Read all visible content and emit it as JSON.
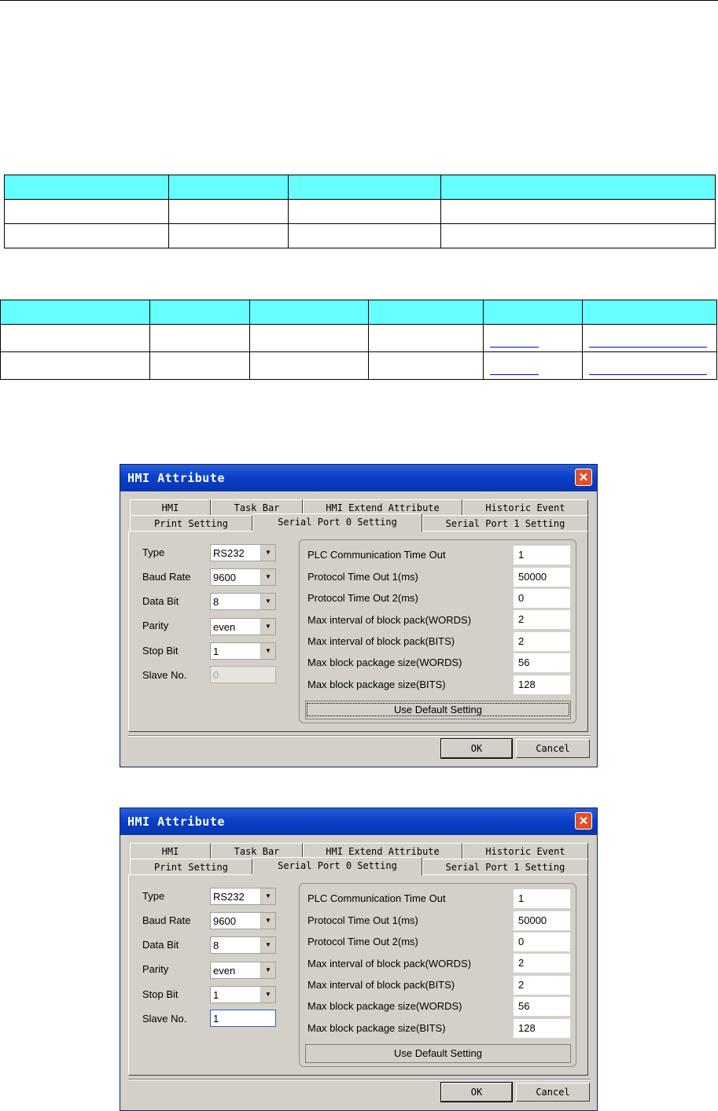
{
  "dialog1": {
    "title": "HMI Attribute",
    "tabs_row1": [
      "HMI",
      "Task Bar",
      "HMI Extend Attribute",
      "Historic Event"
    ],
    "tabs_row2": [
      "Print Setting",
      "Serial Port 0 Setting",
      "Serial Port 1 Setting"
    ],
    "labels": [
      "Type",
      "Baud Rate",
      "Data Bit",
      "Parity",
      "Stop Bit",
      "Slave No."
    ],
    "values": [
      "RS232",
      "9600",
      "8",
      "even",
      "1",
      "0"
    ],
    "params": [
      {
        "label": "PLC Communication Time Out",
        "value": "1"
      },
      {
        "label": "Protocol Time Out 1(ms)",
        "value": "50000"
      },
      {
        "label": "Protocol Time Out 2(ms)",
        "value": "0"
      },
      {
        "label": "Max interval of block pack(WORDS)",
        "value": "2"
      },
      {
        "label": "Max interval of block pack(BITS)",
        "value": "2"
      },
      {
        "label": "Max block package size(WORDS)",
        "value": "56"
      },
      {
        "label": "Max block package size(BITS)",
        "value": "128"
      }
    ],
    "default_button": "Use Default Setting",
    "ok": "OK",
    "cancel": "Cancel"
  },
  "dialog2": {
    "title": "HMI Attribute",
    "tabs_row1": [
      "HMI",
      "Task Bar",
      "HMI Extend Attribute",
      "Historic Event"
    ],
    "tabs_row2": [
      "Print Setting",
      "Serial Port 0 Setting",
      "Serial Port 1 Setting"
    ],
    "labels": [
      "Type",
      "Baud Rate",
      "Data Bit",
      "Parity",
      "Stop Bit",
      "Slave No."
    ],
    "values": [
      "RS232",
      "9600",
      "8",
      "even",
      "1",
      "1"
    ],
    "params": [
      {
        "label": "PLC Communication Time Out",
        "value": "1"
      },
      {
        "label": "Protocol Time Out 1(ms)",
        "value": "50000"
      },
      {
        "label": "Protocol Time Out 2(ms)",
        "value": "0"
      },
      {
        "label": "Max interval of block pack(WORDS)",
        "value": "2"
      },
      {
        "label": "Max interval of block pack(BITS)",
        "value": "2"
      },
      {
        "label": "Max block package size(WORDS)",
        "value": "56"
      },
      {
        "label": "Max block package size(BITS)",
        "value": "128"
      }
    ],
    "default_button": "Use Default Setting",
    "ok": "OK",
    "cancel": "Cancel"
  },
  "colors": {
    "table_header": "#66ffff",
    "titlebar": "#0a40c8",
    "dialog_bg": "#d4d0c8",
    "link": "#0000ff",
    "close_button": "#e0502c"
  }
}
